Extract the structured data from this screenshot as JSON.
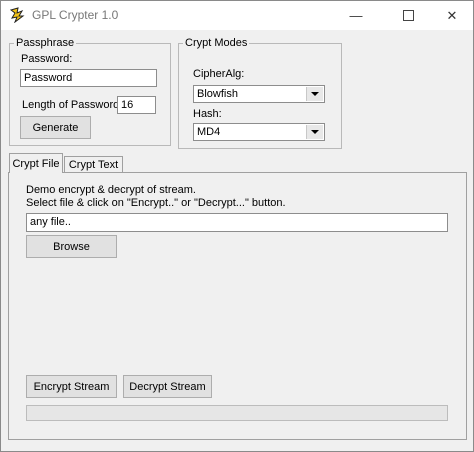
{
  "window": {
    "title": "GPL Crypter 1.0",
    "controls": {
      "minimize": "—",
      "close": "✕"
    }
  },
  "passphrase": {
    "legend": "Passphrase",
    "password_label": "Password:",
    "password_value": "Password",
    "length_label": "Length of Password:",
    "length_value": "16",
    "generate_label": "Generate"
  },
  "crypt_modes": {
    "legend": "Crypt Modes",
    "cipher_label": "CipherAlg:",
    "cipher_value": "Blowfish",
    "hash_label": "Hash:",
    "hash_value": "MD4"
  },
  "tabs": [
    {
      "label": "Crypt File",
      "active": true
    },
    {
      "label": "Crypt Text",
      "active": false
    }
  ],
  "crypt_file": {
    "description_line1": "Demo encrypt & decrypt of stream.",
    "description_line2": "Select file & click on \"Encrypt..\" or \"Decrypt...\" button.",
    "file_value": "any file..",
    "browse_label": "Browse",
    "encrypt_label": "Encrypt Stream",
    "decrypt_label": "Decrypt Stream",
    "progress": 0
  }
}
